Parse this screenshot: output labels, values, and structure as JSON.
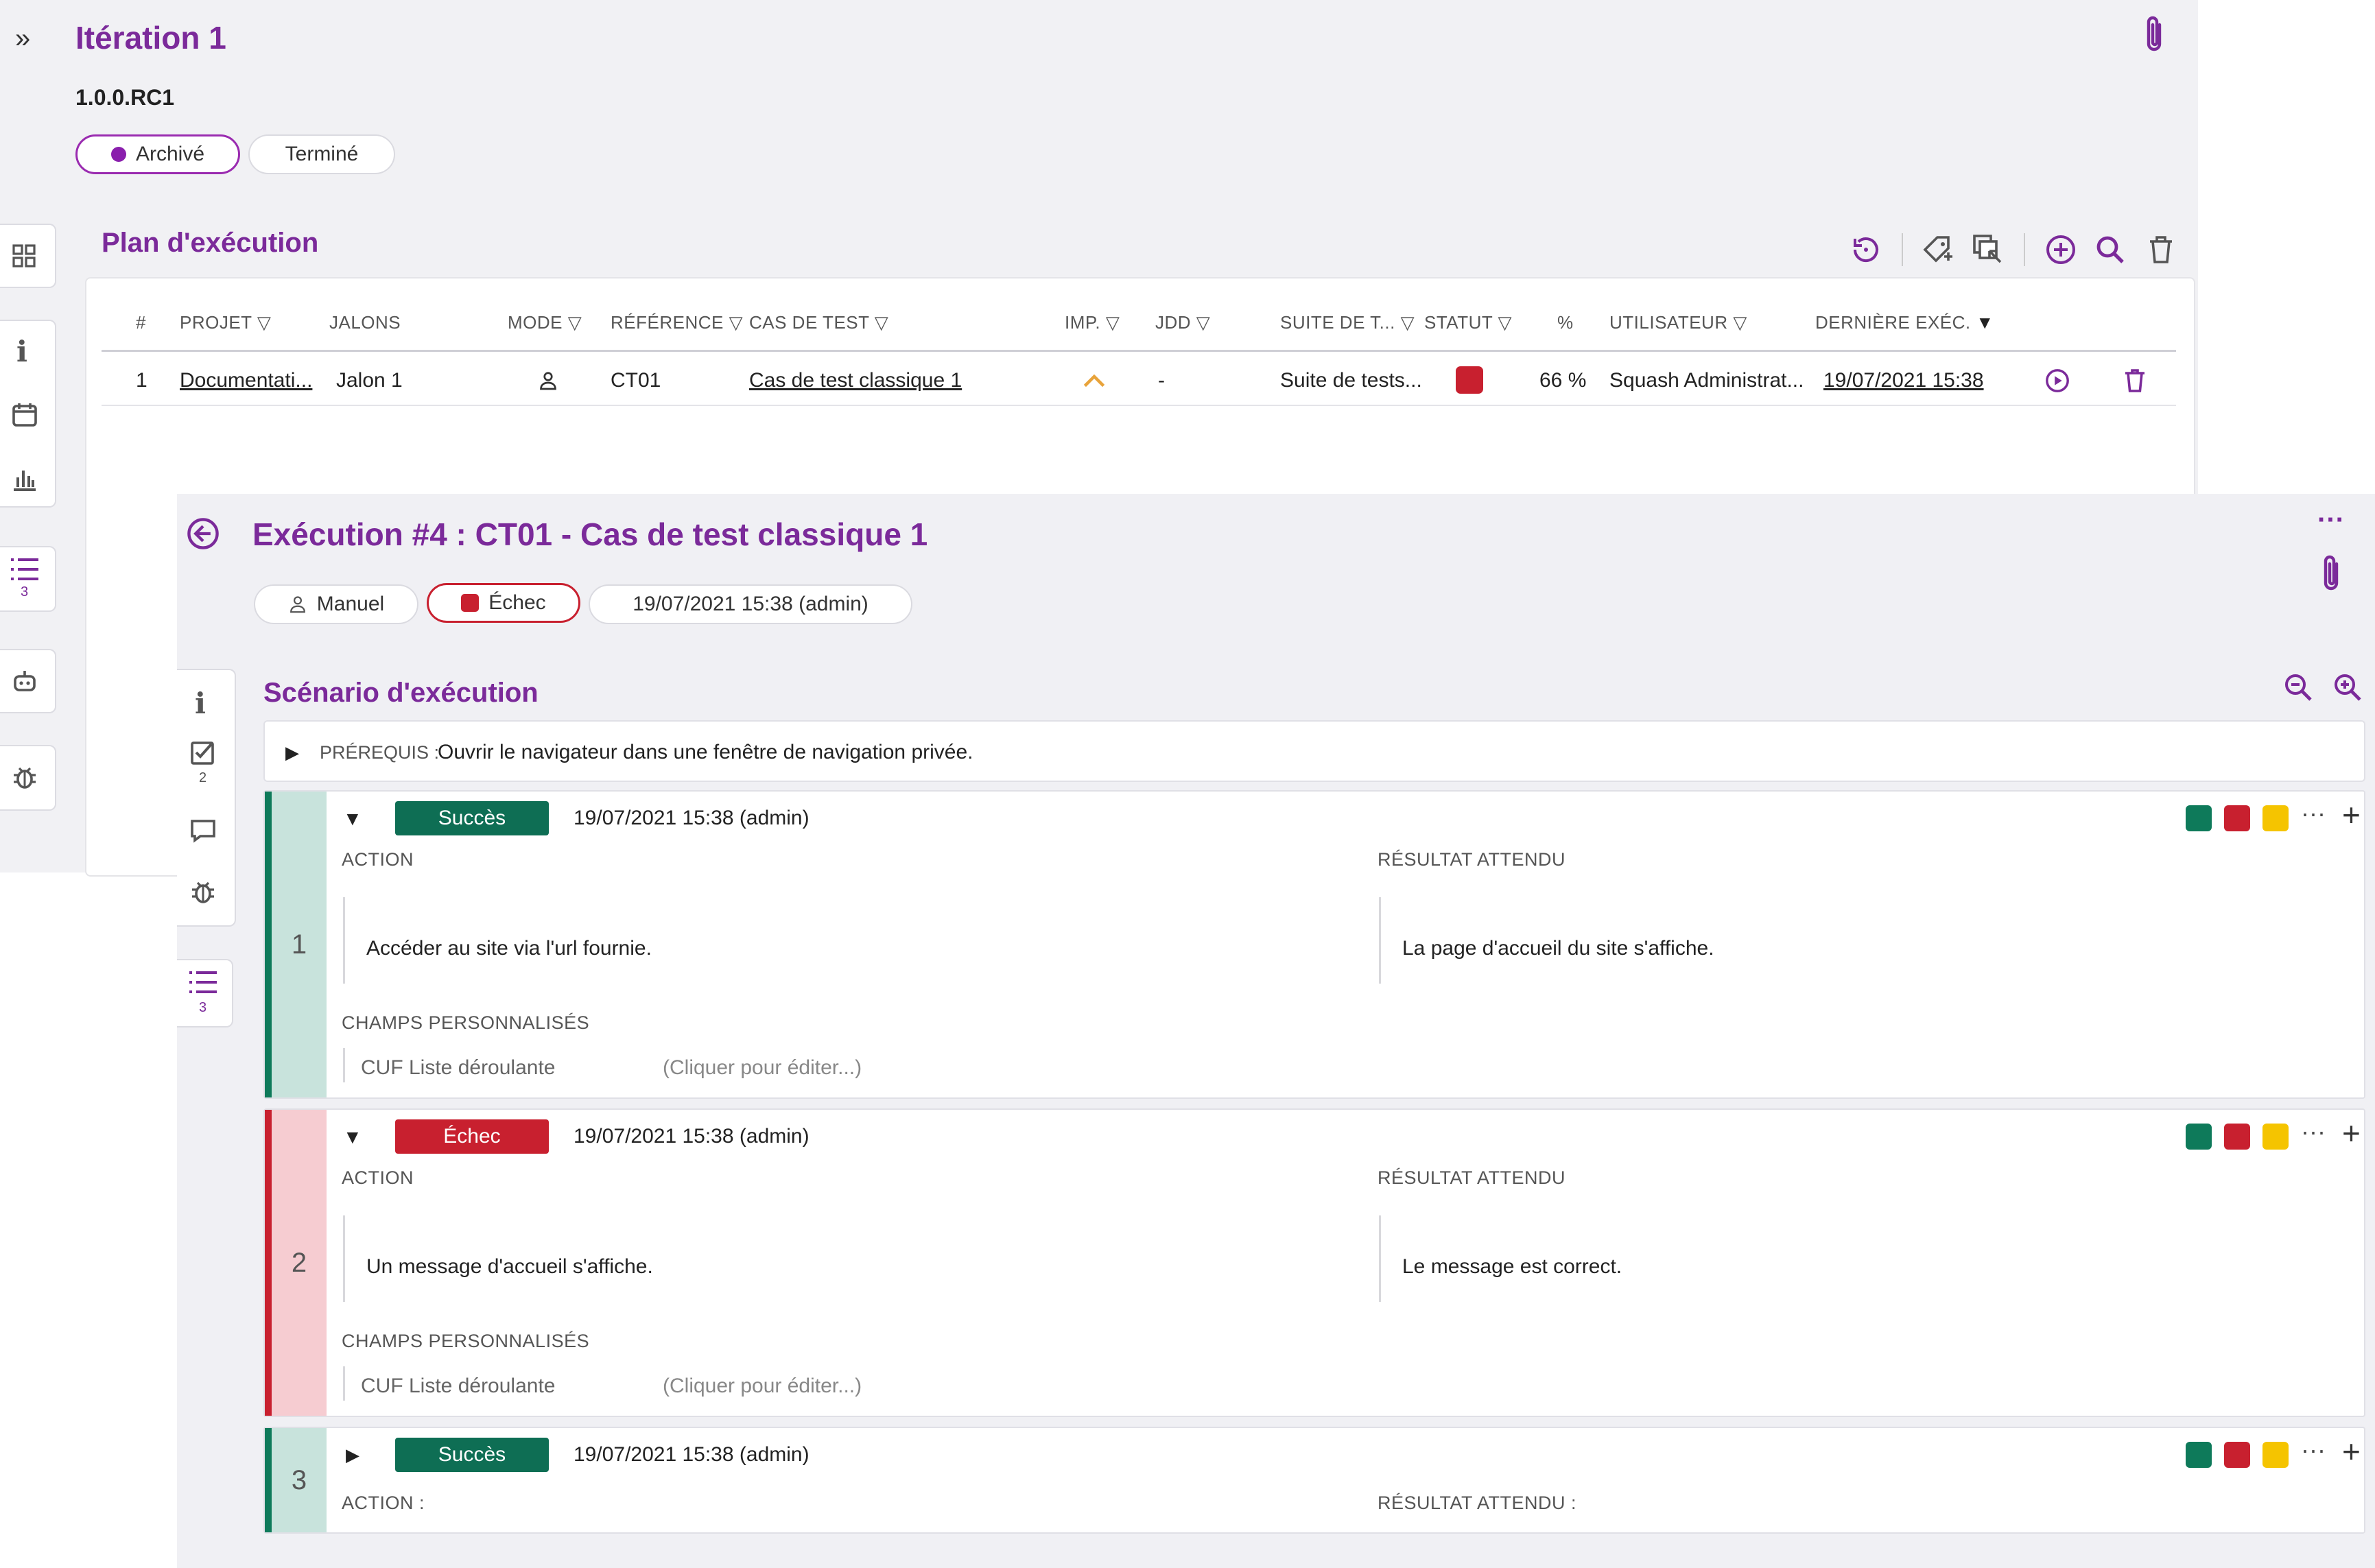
{
  "iteration": {
    "title": "Itération 1",
    "milestone": "1.0.0.RC1",
    "chips": {
      "archived": "Archivé",
      "done": "Terminé"
    },
    "left_nav": {
      "list_count": "3"
    }
  },
  "plan": {
    "title": "Plan d'exécution",
    "headers": [
      "#",
      "PROJET",
      "JALONS",
      "MODE",
      "RÉFÉRENCE",
      "CAS DE TEST",
      "IMP.",
      "JDD",
      "SUITE DE T...",
      "STATUT",
      "%",
      "UTILISATEUR",
      "DERNIÈRE EXÉC."
    ],
    "row": {
      "index": "1",
      "project": "Documentati...",
      "milestone": "Jalon 1",
      "reference": "CT01",
      "test_case": "Cas de test classique 1",
      "dataset": "-",
      "suite": "Suite de tests...",
      "status_color": "#c8202f",
      "percent": "66 %",
      "user": "Squash Administrat...",
      "last_exec": "19/07/2021 15:38"
    }
  },
  "execution": {
    "title": "Exécution #4 : CT01 - Cas de test classique 1",
    "chips": {
      "mode": "Manuel",
      "status": "Échec",
      "date": "19/07/2021 15:38 (admin)"
    },
    "side": {
      "checks_count": "2",
      "list_count": "3"
    },
    "scenario_title": "Scénario d'exécution",
    "prereq_label": "PRÉREQUIS :",
    "prereq_text": "Ouvrir le navigateur dans une fenêtre de navigation privée.",
    "steps": [
      {
        "number": "1",
        "status": "Succès",
        "date": "19/07/2021 15:38 (admin)",
        "action_label": "ACTION",
        "result_label": "RÉSULTAT ATTENDU",
        "action": "Accéder au site via l'url fournie.",
        "result": "La page d'accueil du site s'affiche.",
        "custom_label": "CHAMPS PERSONNALISÉS",
        "cuf_name": "CUF Liste déroulante",
        "cuf_value": "(Cliquer pour éditer...)"
      },
      {
        "number": "2",
        "status": "Échec",
        "date": "19/07/2021 15:38 (admin)",
        "action_label": "ACTION",
        "result_label": "RÉSULTAT ATTENDU",
        "action": "Un message d'accueil s'affiche.",
        "result": "Le message est correct.",
        "custom_label": "CHAMPS PERSONNALISÉS",
        "cuf_name": "CUF Liste déroulante",
        "cuf_value": "(Cliquer pour éditer...)"
      },
      {
        "number": "3",
        "status": "Succès",
        "date": "19/07/2021 15:38 (admin)",
        "action_label": "ACTION :",
        "result_label": "RÉSULTAT ATTENDU :"
      }
    ]
  },
  "colors": {
    "accent": "#7b2a9a",
    "success": "#0e7a5a",
    "failure": "#c8202f",
    "warning": "#f5c400",
    "importance": "#e8a33a"
  }
}
